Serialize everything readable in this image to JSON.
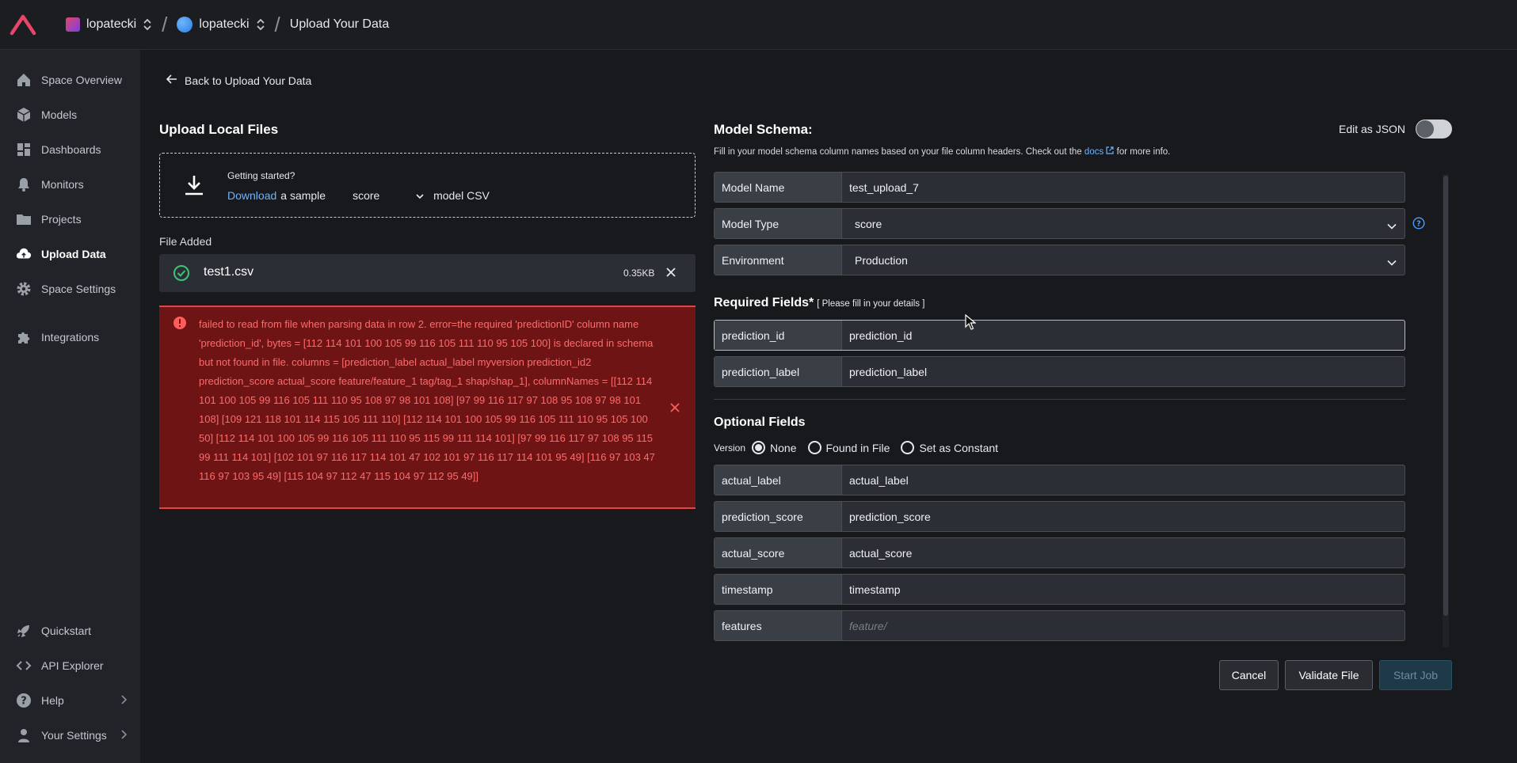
{
  "topbar": {
    "org_name": "lopatecki",
    "space_name": "lopatecki",
    "page": "Upload Your Data"
  },
  "sidebar": {
    "items": [
      {
        "label": "Space Overview",
        "icon": "home-icon"
      },
      {
        "label": "Models",
        "icon": "cube-icon"
      },
      {
        "label": "Dashboards",
        "icon": "dashboard-icon"
      },
      {
        "label": "Monitors",
        "icon": "bell-icon"
      },
      {
        "label": "Projects",
        "icon": "folder-icon"
      },
      {
        "label": "Upload Data",
        "icon": "cloud-upload-icon",
        "active": true
      },
      {
        "label": "Space Settings",
        "icon": "gear-icon"
      },
      {
        "label": "Integrations",
        "icon": "puzzle-icon"
      }
    ],
    "bottom": [
      {
        "label": "Quickstart",
        "icon": "rocket-icon"
      },
      {
        "label": "API Explorer",
        "icon": "code-icon"
      },
      {
        "label": "Help",
        "icon": "help-icon"
      },
      {
        "label": "Your Settings",
        "icon": "user-icon"
      }
    ]
  },
  "back_link": "Back to Upload Your Data",
  "upload": {
    "title": "Upload Local Files",
    "getting_started": "Getting started?",
    "download_link": "Download",
    "download_text": "a sample",
    "sample_type": "score",
    "model_csv": "model CSV",
    "file_added_label": "File Added",
    "file_name": "test1.csv",
    "file_size": "0.35KB",
    "error": "failed to read from file when parsing data in row 2. error=the required 'predictionID' column name 'prediction_id', bytes = [112 114 101 100 105 99 116 105 111 110 95 105 100] is declared in schema but not found in file. columns = [prediction_label actual_label myversion prediction_id2 prediction_score actual_score feature/feature_1 tag/tag_1 shap/shap_1], columnNames = [[112 114 101 100 105 99 116 105 111 110 95 108 97 98 101 108] [97 99 116 117 97 108 95 108 97 98 101 108] [109 121 118 101 114 115 105 111 110] [112 114 101 100 105 99 116 105 111 110 95 105 100 50] [112 114 101 100 105 99 116 105 111 110 95 115 99 111 114 101] [97 99 116 117 97 108 95 115 99 111 114 101] [102 101 97 116 117 114 101 47 102 101 97 116 117 114 101 95 49] [116 97 103 47 116 97 103 95 49] [115 104 97 112 47 115 104 97 112 95 49]]"
  },
  "schema": {
    "title": "Model Schema:",
    "edit_json": "Edit as JSON",
    "desc_before": "Fill in your model schema column names based on your file column headers. Check out the",
    "docs_link": "docs",
    "desc_after": "for more info.",
    "model_name_label": "Model Name",
    "model_name_value": "test_upload_7",
    "model_type_label": "Model Type",
    "model_type_value": "score",
    "environment_label": "Environment",
    "environment_value": "Production",
    "required_title": "Required Fields*",
    "required_sub": "[ Please fill in your details ]",
    "required": [
      {
        "label": "prediction_id",
        "value": "prediction_id"
      },
      {
        "label": "prediction_label",
        "value": "prediction_label"
      }
    ],
    "optional_title": "Optional Fields",
    "version_label": "Version",
    "version_options": [
      "None",
      "Found in File",
      "Set as Constant"
    ],
    "optional": [
      {
        "label": "actual_label",
        "value": "actual_label"
      },
      {
        "label": "prediction_score",
        "value": "prediction_score"
      },
      {
        "label": "actual_score",
        "value": "actual_score"
      },
      {
        "label": "timestamp",
        "value": "timestamp"
      },
      {
        "label": "features",
        "placeholder": "feature/"
      }
    ]
  },
  "actions": {
    "cancel": "Cancel",
    "validate": "Validate File",
    "start": "Start Job"
  },
  "colors": {
    "accent_link": "#6cb4ff",
    "error_bg": "#6e1414",
    "error_text": "#ff6b6b",
    "logo": "#e8456b",
    "success": "#3ec47a"
  }
}
